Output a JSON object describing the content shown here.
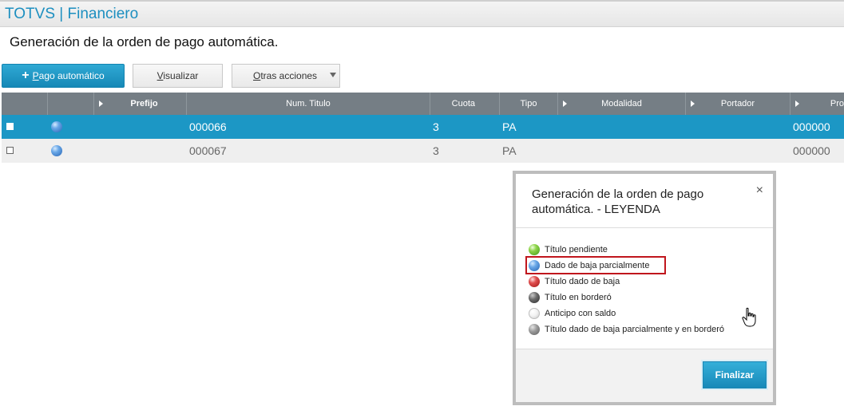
{
  "app": {
    "title": "TOTVS | Financiero"
  },
  "page": {
    "title": "Generación de la orden de pago automática."
  },
  "toolbar": {
    "pago_label": "Pago automático",
    "visualizar_label": "Visualizar",
    "otras_label": "Otras acciones"
  },
  "grid": {
    "columns": {
      "prefijo": "Prefijo",
      "num_titulo": "Num. Titulo",
      "cuota": "Cuota",
      "tipo": "Tipo",
      "modalidad": "Modalidad",
      "portador": "Portador",
      "pro": "Pro"
    },
    "rows": [
      {
        "status": "blue",
        "num_titulo": "000066",
        "cuota": "3",
        "tipo": "PA",
        "pro": "000000",
        "selected": true
      },
      {
        "status": "blue",
        "num_titulo": "000067",
        "cuota": "3",
        "tipo": "PA",
        "pro": "000000",
        "selected": false
      }
    ]
  },
  "legend_dialog": {
    "title": "Generación de la orden de pago automática. - LEYENDA",
    "close_glyph": "×",
    "items": [
      {
        "color": "green",
        "label": "Título pendiente"
      },
      {
        "color": "blue",
        "label": "Dado de baja parcialmente"
      },
      {
        "color": "red",
        "label": "Título dado de baja"
      },
      {
        "color": "dark",
        "label": "Título en borderó"
      },
      {
        "color": "white",
        "label": "Anticipo con saldo"
      },
      {
        "color": "gray",
        "label": "Título dado de baja parcialmente y en borderó"
      }
    ],
    "finalizar_label": "Finalizar"
  },
  "colors": {
    "accent": "#1c97c5",
    "header_bg": "#757e85",
    "highlight": "#c0161d"
  }
}
